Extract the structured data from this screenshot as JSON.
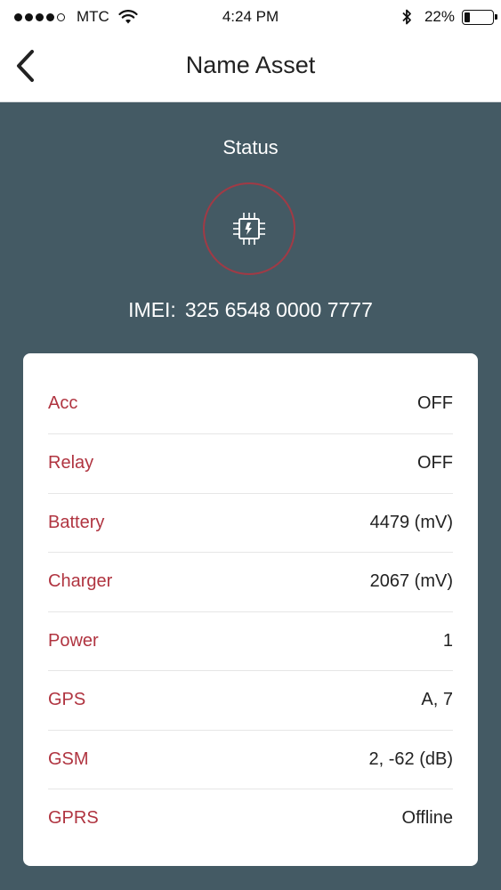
{
  "status_bar": {
    "carrier": "MTC",
    "time": "4:24 PM",
    "battery_percent": "22%",
    "battery_level": 0.22,
    "signal_bars_filled": 4,
    "signal_bars_total": 5
  },
  "header": {
    "title": "Name Asset",
    "back_icon": "chevron-left-icon"
  },
  "status": {
    "label": "Status",
    "icon": "chip-icon",
    "ring_color": "#a13a45",
    "imei_label": "IMEI:",
    "imei_value": "325 6548 0000 7777"
  },
  "details": [
    {
      "label": "Acc",
      "value": "OFF"
    },
    {
      "label": "Relay",
      "value": "OFF"
    },
    {
      "label": "Battery",
      "value": "4479 (mV)"
    },
    {
      "label": "Charger",
      "value": "2067 (mV)"
    },
    {
      "label": "Power",
      "value": "1"
    },
    {
      "label": "GPS",
      "value": "A, 7"
    },
    {
      "label": "GSM",
      "value": "2, -62 (dB)"
    },
    {
      "label": "GPRS",
      "value": "Offline"
    }
  ],
  "colors": {
    "background": "#445a64",
    "label_accent": "#b03440",
    "card": "#ffffff"
  }
}
